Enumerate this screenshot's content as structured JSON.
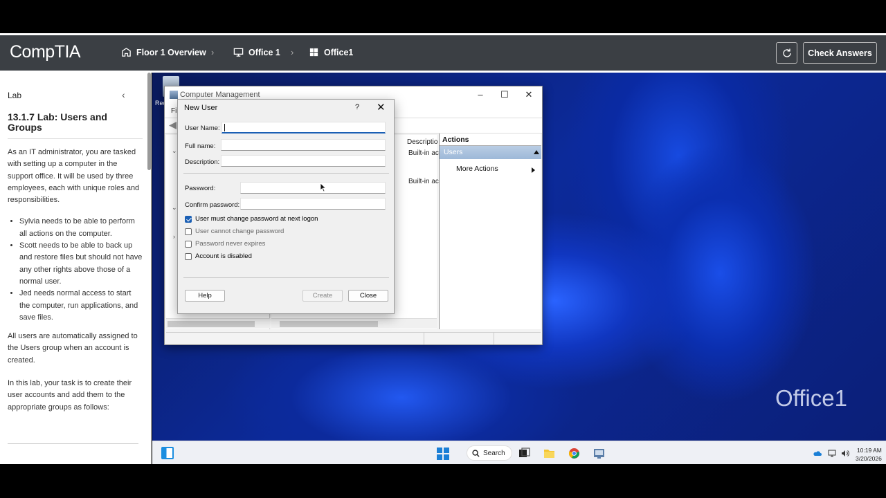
{
  "header": {
    "logo": "CompTIA",
    "breadcrumbs": [
      {
        "label": "Floor 1 Overview",
        "icon": "building-icon"
      },
      {
        "label": "Office 1",
        "icon": "monitor-icon"
      },
      {
        "label": "Office1",
        "icon": "windows-icon"
      }
    ],
    "separator": "›",
    "check_answers_label": "Check Answers"
  },
  "sidebar": {
    "section_label": "Lab",
    "title": "13.1.7 Lab: Users and Groups",
    "intro": "As an IT administrator, you are tasked with setting up a computer in the support office. It will be used by three employees, each with unique roles and responsibilities.",
    "bullets": [
      "Sylvia needs to be able to perform all actions on the computer.",
      "Scott needs to be able to back up and restore files but should not have any other rights above those of a normal user.",
      "Jed needs normal access to start the computer, run applications, and save files."
    ],
    "para2": "All users are automatically assigned to the Users group when an account is created.",
    "para3": "In this lab, your task is to create their user accounts and add them to the appropriate groups as follows:"
  },
  "desktop": {
    "watermark": "Office1",
    "icon_label": "Rec"
  },
  "computer_management": {
    "title": "Computer Management",
    "menu_first": "Fil",
    "column_description": "Descriptio",
    "rows": [
      "Built-in ac",
      "Built-in ac"
    ],
    "actions_header": "Actions",
    "actions_selected": "Users",
    "more_actions": "More Actions"
  },
  "new_user_dialog": {
    "title": "New User",
    "help_glyph": "?",
    "close_glyph": "✕",
    "fields": {
      "user_name_label": "User Name:",
      "full_name_label": "Full name:",
      "description_label": "Description:",
      "password_label": "Password:",
      "confirm_password_label": "Confirm password:",
      "user_name_value": "",
      "full_name_value": "",
      "description_value": "",
      "password_value": "",
      "confirm_password_value": ""
    },
    "checkboxes": [
      {
        "label": "User must change password at next logon",
        "checked": true,
        "enabled": true
      },
      {
        "label": "User cannot change password",
        "checked": false,
        "enabled": false
      },
      {
        "label": "Password never expires",
        "checked": false,
        "enabled": false
      },
      {
        "label": "Account is disabled",
        "checked": false,
        "enabled": true
      }
    ],
    "buttons": {
      "help": "Help",
      "create": "Create",
      "close": "Close"
    }
  },
  "taskbar": {
    "search_label": "Search",
    "time": "10:19 AM",
    "date": "3/20/2026"
  },
  "colors": {
    "header_bg": "#3b3f44",
    "accent": "#1a5fb4",
    "actions_selected_bg": "#a9c2df"
  }
}
